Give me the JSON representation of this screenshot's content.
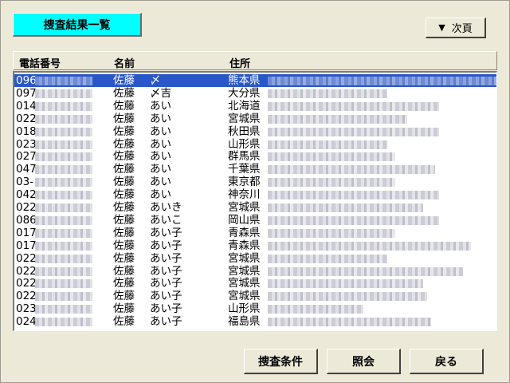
{
  "title": "捜査結果一覧",
  "next_button": {
    "icon": "▼",
    "label": "次頁"
  },
  "columns": {
    "phone": "電話番号",
    "name": "名前",
    "address": "住所"
  },
  "rows": [
    {
      "phone": "096",
      "surname": "佐藤",
      "given": "〆",
      "pref": "熊本県",
      "selected": true
    },
    {
      "phone": "097",
      "surname": "佐藤",
      "given": "〆吉",
      "pref": "大分県"
    },
    {
      "phone": "014",
      "surname": "佐藤",
      "given": "あい",
      "pref": "北海道"
    },
    {
      "phone": "022",
      "surname": "佐藤",
      "given": "あい",
      "pref": "宮城県"
    },
    {
      "phone": "018",
      "surname": "佐藤",
      "given": "あい",
      "pref": "秋田県"
    },
    {
      "phone": "023",
      "surname": "佐藤",
      "given": "あい",
      "pref": "山形県"
    },
    {
      "phone": "027",
      "surname": "佐藤",
      "given": "あい",
      "pref": "群馬県"
    },
    {
      "phone": "047",
      "surname": "佐藤",
      "given": "あい",
      "pref": "千葉県"
    },
    {
      "phone": "03-",
      "surname": "佐藤",
      "given": "あい",
      "pref": "東京都"
    },
    {
      "phone": "042",
      "surname": "佐藤",
      "given": "あい",
      "pref": "神奈川"
    },
    {
      "phone": "022",
      "surname": "佐藤",
      "given": "あいき",
      "pref": "宮城県"
    },
    {
      "phone": "086",
      "surname": "佐藤",
      "given": "あいこ",
      "pref": "岡山県"
    },
    {
      "phone": "017",
      "surname": "佐藤",
      "given": "あい子",
      "pref": "青森県"
    },
    {
      "phone": "017",
      "surname": "佐藤",
      "given": "あい子",
      "pref": "青森県"
    },
    {
      "phone": "022",
      "surname": "佐藤",
      "given": "あい子",
      "pref": "宮城県"
    },
    {
      "phone": "022",
      "surname": "佐藤",
      "given": "あい子",
      "pref": "宮城県"
    },
    {
      "phone": "022",
      "surname": "佐藤",
      "given": "あい子",
      "pref": "宮城県"
    },
    {
      "phone": "022",
      "surname": "佐藤",
      "given": "あい子",
      "pref": "宮城県"
    },
    {
      "phone": "023",
      "surname": "佐藤",
      "given": "あい子",
      "pref": "山形県"
    },
    {
      "phone": "024",
      "surname": "佐藤",
      "given": "あい子",
      "pref": "福島県"
    }
  ],
  "buttons": {
    "search_conditions": "捜査条件",
    "inquiry": "照会",
    "back": "戻る"
  },
  "colors": {
    "title_bg": "#00ffff",
    "selection": "#2a57c8",
    "window_bg": "#ece9d8"
  }
}
